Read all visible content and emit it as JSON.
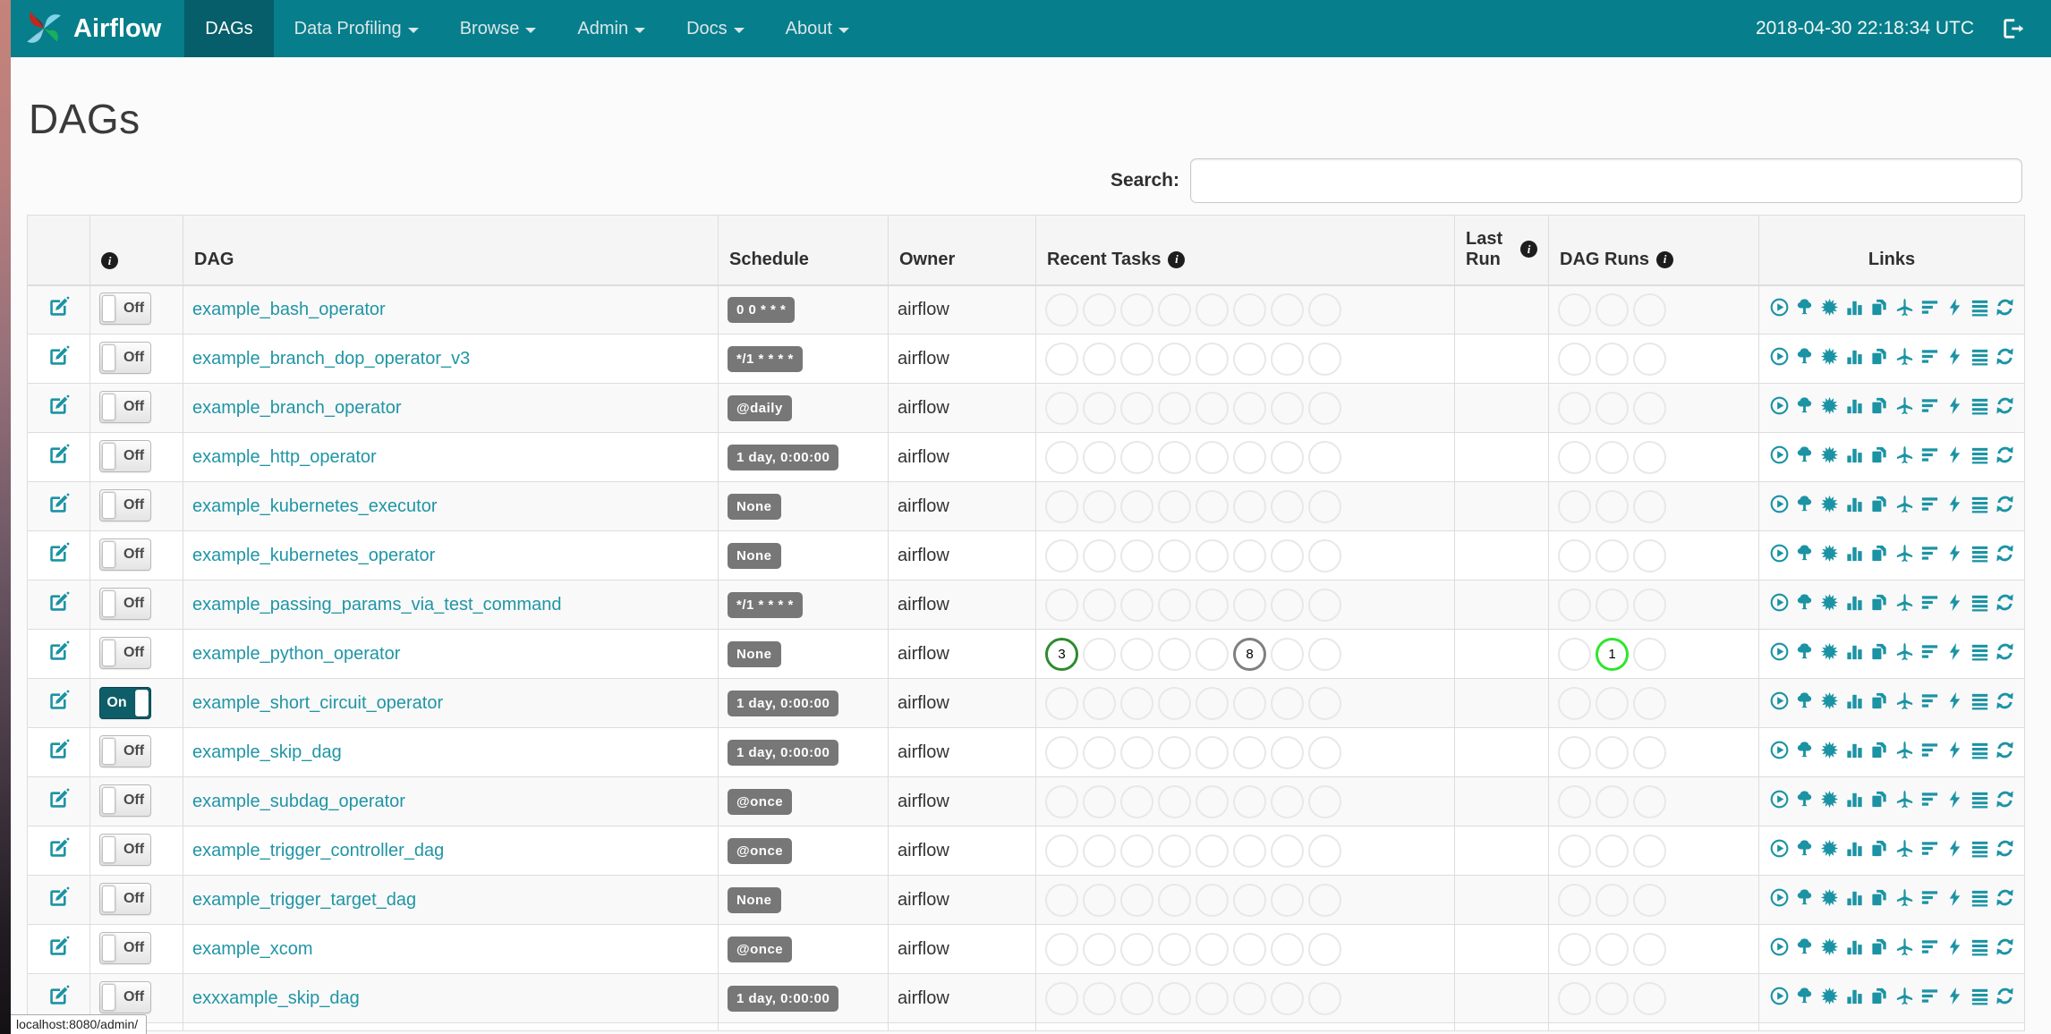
{
  "navbar": {
    "brand": "Airflow",
    "items": [
      {
        "label": "DAGs",
        "active": true,
        "caret": false
      },
      {
        "label": "Data Profiling",
        "active": false,
        "caret": true
      },
      {
        "label": "Browse",
        "active": false,
        "caret": true
      },
      {
        "label": "Admin",
        "active": false,
        "caret": true
      },
      {
        "label": "Docs",
        "active": false,
        "caret": true
      },
      {
        "label": "About",
        "active": false,
        "caret": true
      }
    ],
    "clock": "2018-04-30 22:18:34 UTC"
  },
  "page": {
    "title": "DAGs"
  },
  "search": {
    "label": "Search:",
    "value": ""
  },
  "icons": {
    "info_glyph": "i"
  },
  "colors": {
    "navbar": "#077E8B",
    "navbar_active": "#055E6A",
    "link_teal": "#2095a5",
    "icon_teal": "#1b93a4",
    "badge_gray": "#777777",
    "toggle_on": "#0d5e69",
    "state_success": "#2e8b2e",
    "state_queued": "#808080",
    "state_running": "#2ee52e"
  },
  "table": {
    "columns": [
      {
        "name": "edit",
        "label": "",
        "info_icon": false
      },
      {
        "name": "toggle",
        "label": "",
        "info_icon": true
      },
      {
        "name": "dag",
        "label": "DAG",
        "info_icon": false
      },
      {
        "name": "schedule",
        "label": "Schedule",
        "info_icon": false
      },
      {
        "name": "owner",
        "label": "Owner",
        "info_icon": false
      },
      {
        "name": "recent-tasks",
        "label": "Recent Tasks",
        "info_icon": true
      },
      {
        "name": "last-run",
        "label": "Last Run",
        "info_icon": true
      },
      {
        "name": "dag-runs",
        "label": "DAG Runs",
        "info_icon": true
      },
      {
        "name": "links",
        "label": "Links",
        "info_icon": false
      }
    ],
    "toggle_labels": {
      "on": "On",
      "off": "Off"
    },
    "recent_task_slots": 8,
    "dag_run_slots": 3,
    "link_icons": [
      "trigger-dag",
      "tree-view",
      "graph-view",
      "task-duration",
      "task-tries",
      "landing-times",
      "gantt",
      "code-view",
      "logs",
      "refresh"
    ],
    "rows": [
      {
        "dag": "example_bash_operator",
        "toggle": "Off",
        "schedule": "0 0 * * *",
        "owner": "airflow",
        "last_run": "",
        "recent_tasks": [],
        "dag_runs": []
      },
      {
        "dag": "example_branch_dop_operator_v3",
        "toggle": "Off",
        "schedule": "*/1 * * * *",
        "owner": "airflow",
        "last_run": "",
        "recent_tasks": [],
        "dag_runs": []
      },
      {
        "dag": "example_branch_operator",
        "toggle": "Off",
        "schedule": "@daily",
        "owner": "airflow",
        "last_run": "",
        "recent_tasks": [],
        "dag_runs": []
      },
      {
        "dag": "example_http_operator",
        "toggle": "Off",
        "schedule": "1 day, 0:00:00",
        "owner": "airflow",
        "last_run": "",
        "recent_tasks": [],
        "dag_runs": []
      },
      {
        "dag": "example_kubernetes_executor",
        "toggle": "Off",
        "schedule": "None",
        "owner": "airflow",
        "last_run": "",
        "recent_tasks": [],
        "dag_runs": []
      },
      {
        "dag": "example_kubernetes_operator",
        "toggle": "Off",
        "schedule": "None",
        "owner": "airflow",
        "last_run": "",
        "recent_tasks": [],
        "dag_runs": []
      },
      {
        "dag": "example_passing_params_via_test_command",
        "toggle": "Off",
        "schedule": "*/1 * * * *",
        "owner": "airflow",
        "last_run": "",
        "recent_tasks": [],
        "dag_runs": []
      },
      {
        "dag": "example_python_operator",
        "toggle": "Off",
        "schedule": "None",
        "owner": "airflow",
        "last_run": "",
        "recent_tasks": [
          {
            "slot": 0,
            "count": "3",
            "color": "#2e8b2e"
          },
          {
            "slot": 5,
            "count": "8",
            "color": "#808080"
          }
        ],
        "dag_runs": [
          {
            "slot": 1,
            "count": "1",
            "color": "#2ee52e"
          }
        ]
      },
      {
        "dag": "example_short_circuit_operator",
        "toggle": "On",
        "schedule": "1 day, 0:00:00",
        "owner": "airflow",
        "last_run": "",
        "recent_tasks": [],
        "dag_runs": []
      },
      {
        "dag": "example_skip_dag",
        "toggle": "Off",
        "schedule": "1 day, 0:00:00",
        "owner": "airflow",
        "last_run": "",
        "recent_tasks": [],
        "dag_runs": []
      },
      {
        "dag": "example_subdag_operator",
        "toggle": "Off",
        "schedule": "@once",
        "owner": "airflow",
        "last_run": "",
        "recent_tasks": [],
        "dag_runs": []
      },
      {
        "dag": "example_trigger_controller_dag",
        "toggle": "Off",
        "schedule": "@once",
        "owner": "airflow",
        "last_run": "",
        "recent_tasks": [],
        "dag_runs": []
      },
      {
        "dag": "example_trigger_target_dag",
        "toggle": "Off",
        "schedule": "None",
        "owner": "airflow",
        "last_run": "",
        "recent_tasks": [],
        "dag_runs": []
      },
      {
        "dag": "example_xcom",
        "toggle": "Off",
        "schedule": "@once",
        "owner": "airflow",
        "last_run": "",
        "recent_tasks": [],
        "dag_runs": []
      },
      {
        "dag": "exxxample_skip_dag",
        "toggle": "Off",
        "schedule": "1 day, 0:00:00",
        "owner": "airflow",
        "last_run": "",
        "recent_tasks": [],
        "dag_runs": []
      }
    ]
  },
  "status_bar": {
    "text": "localhost:8080/admin/"
  }
}
